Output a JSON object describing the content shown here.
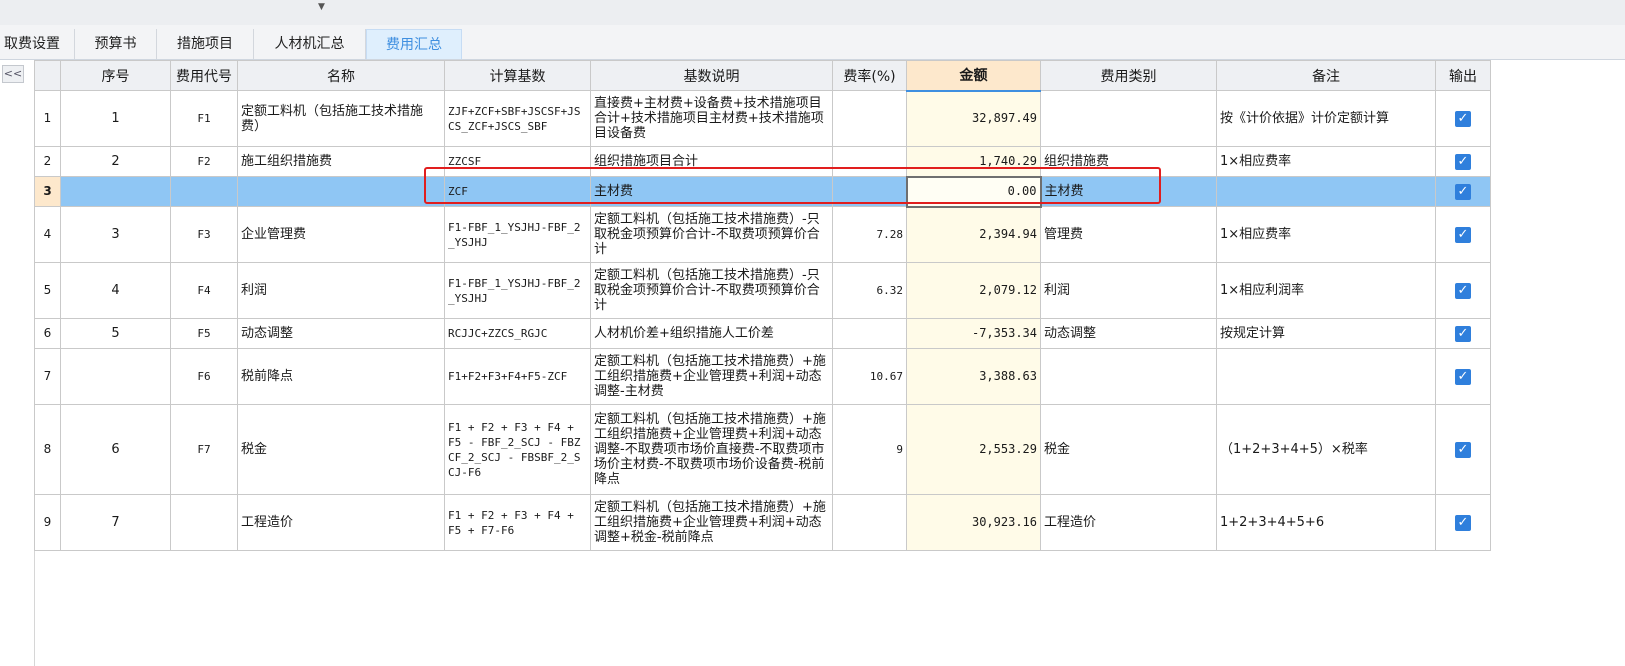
{
  "tabs": [
    {
      "label": "取费设置",
      "active": false
    },
    {
      "label": "预算书",
      "active": false
    },
    {
      "label": "措施项目",
      "active": false
    },
    {
      "label": "人材机汇总",
      "active": false
    },
    {
      "label": "费用汇总",
      "active": true
    }
  ],
  "collapse_button": "<<",
  "columns": [
    "序号",
    "费用代号",
    "名称",
    "计算基数",
    "基数说明",
    "费率(%)",
    "金额",
    "费用类别",
    "备注",
    "输出"
  ],
  "rows": [
    {
      "rownum": "1",
      "seq": "1",
      "code": "F1",
      "name": "定额工料机（包括施工技术措施费）",
      "base": "ZJF+ZCF+SBF+JSCSF+JSCS_ZCF+JSCS_SBF",
      "desc": "直接费+主材费+设备费+技术措施项目合计+技术措施项目主材费+技术措施项目设备费",
      "rate": "",
      "amount": "32,897.49",
      "category": "",
      "remark": "按《计价依据》计价定额计算",
      "output": true
    },
    {
      "rownum": "2",
      "seq": "2",
      "code": "F2",
      "name": "施工组织措施费",
      "base": "ZZCSF",
      "desc": "组织措施项目合计",
      "rate": "",
      "amount": "1,740.29",
      "category": "组织措施费",
      "remark": "1×相应费率",
      "output": true
    },
    {
      "rownum": "3",
      "seq": "",
      "code": "",
      "name": "",
      "base": "ZCF",
      "desc": "主材费",
      "rate": "",
      "amount": "0.00",
      "category": "主材费",
      "remark": "",
      "output": true
    },
    {
      "rownum": "4",
      "seq": "3",
      "code": "F3",
      "name": "企业管理费",
      "base": "F1-FBF_1_YSJHJ-FBF_2_YSJHJ",
      "desc": "定额工料机（包括施工技术措施费）-只取税金项预算价合计-不取费项预算价合计",
      "rate": "7.28",
      "amount": "2,394.94",
      "category": "管理费",
      "remark": "1×相应费率",
      "output": true
    },
    {
      "rownum": "5",
      "seq": "4",
      "code": "F4",
      "name": "利润",
      "base": "F1-FBF_1_YSJHJ-FBF_2_YSJHJ",
      "desc": "定额工料机（包括施工技术措施费）-只取税金项预算价合计-不取费项预算价合计",
      "rate": "6.32",
      "amount": "2,079.12",
      "category": "利润",
      "remark": "1×相应利润率",
      "output": true
    },
    {
      "rownum": "6",
      "seq": "5",
      "code": "F5",
      "name": "动态调整",
      "base": "RCJJC+ZZCS_RGJC",
      "desc": "人材机价差+组织措施人工价差",
      "rate": "",
      "amount": "-7,353.34",
      "category": "动态调整",
      "remark": "按规定计算",
      "output": true
    },
    {
      "rownum": "7",
      "seq": "",
      "code": "F6",
      "name": "税前降点",
      "base": "F1+F2+F3+F4+F5-ZCF",
      "desc": "定额工料机（包括施工技术措施费）+施工组织措施费+企业管理费+利润+动态调整-主材费",
      "rate": "10.67",
      "amount": "3,388.63",
      "category": "",
      "remark": "",
      "output": true
    },
    {
      "rownum": "8",
      "seq": "6",
      "code": "F7",
      "name": "税金",
      "base": "F1 + F2 + F3 + F4 + F5 - FBF_2_SCJ - FBZCF_2_SCJ - FBSBF_2_SCJ-F6",
      "desc": "定额工料机（包括施工技术措施费）+施工组织措施费+企业管理费+利润+动态调整-不取费项市场价直接费-不取费项市场价主材费-不取费项市场价设备费-税前降点",
      "rate": "9",
      "amount": "2,553.29",
      "category": "税金",
      "remark": "（1+2+3+4+5）×税率",
      "output": true
    },
    {
      "rownum": "9",
      "seq": "7",
      "code": "",
      "name": "工程造价",
      "base": "F1 + F2 + F3 + F4 + F5 + F7-F6",
      "desc": "定额工料机（包括施工技术措施费）+施工组织措施费+企业管理费+利润+动态调整+税金-税前降点",
      "rate": "",
      "amount": "30,923.16",
      "category": "工程造价",
      "remark": "1+2+3+4+5+6",
      "output": true
    }
  ],
  "checkmark": "✓",
  "selected_row": 2
}
